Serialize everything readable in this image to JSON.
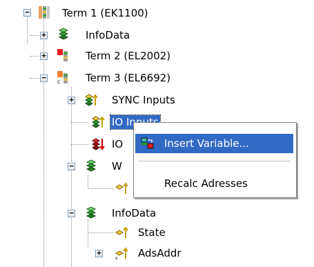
{
  "tree": {
    "items": [
      {
        "label": "Term 1 (EK1100)",
        "icon": "ethercat-coupler-icon",
        "expander": "−"
      },
      {
        "label": "InfoData",
        "icon": "infodata-icon",
        "expander": "+"
      },
      {
        "label": "Term 2 (EL2002)",
        "icon": "digital-output-terminal-icon",
        "expander": "+"
      },
      {
        "label": "Term 3 (EL6692)",
        "icon": "bridge-terminal-icon",
        "expander": "−"
      },
      {
        "label": "SYNC Inputs",
        "icon": "input-variable-icon",
        "expander": "+"
      },
      {
        "label": "IO Inputs",
        "icon": "input-variable-icon",
        "expander": ""
      },
      {
        "label": "IO",
        "icon": "output-variable-icon",
        "expander": ""
      },
      {
        "label": "W",
        "icon": "infodata-icon",
        "expander": "−"
      },
      {
        "label": "",
        "icon": "input-variable-icon",
        "expander": ""
      },
      {
        "label": "InfoData",
        "icon": "infodata-icon",
        "expander": "−"
      },
      {
        "label": "State",
        "icon": "input-variable-icon",
        "expander": ""
      },
      {
        "label": "AdsAddr",
        "icon": "input-variable-icon",
        "expander": "+"
      }
    ]
  },
  "context_menu": {
    "items": [
      {
        "label": "Insert Variable...",
        "icon": "insert-variable-icon",
        "highlighted": true
      },
      {
        "label": "Recalc Adresses",
        "icon": "",
        "highlighted": false
      }
    ]
  },
  "colors": {
    "selection": "#316ac5",
    "expander_border": "#7f9db9",
    "input_arrow": "#c8a000",
    "output_arrow": "#d00000"
  }
}
